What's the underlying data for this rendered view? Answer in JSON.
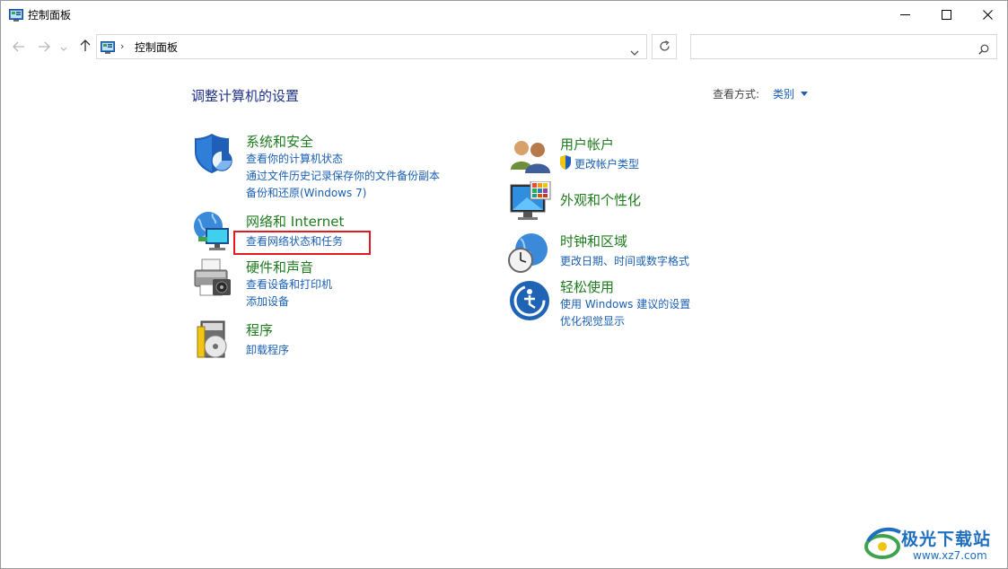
{
  "window": {
    "title": "控制面板",
    "minimize_icon": "minimize-icon",
    "maximize_icon": "maximize-icon",
    "close_icon": "close-icon"
  },
  "nav": {
    "back_icon": "arrow-left-icon",
    "forward_icon": "arrow-right-icon",
    "recent_icon": "chevron-down-icon",
    "up_icon": "arrow-up-icon",
    "breadcrumb_separator": "›",
    "breadcrumb": "控制面板",
    "search_placeholder": "",
    "search_value": ""
  },
  "content": {
    "heading": "调整计算机的设置",
    "view_by_label": "查看方式:",
    "view_by_value": "类别"
  },
  "categories": {
    "system_security": {
      "title": "系统和安全",
      "links": [
        "查看你的计算机状态",
        "通过文件历史记录保存你的文件备份副本",
        "备份和还原(Windows 7)"
      ]
    },
    "network": {
      "title": "网络和 Internet",
      "links": [
        "查看网络状态和任务"
      ]
    },
    "hardware": {
      "title": "硬件和声音",
      "links": [
        "查看设备和打印机",
        "添加设备"
      ]
    },
    "programs": {
      "title": "程序",
      "links": [
        "卸载程序"
      ]
    },
    "user_accounts": {
      "title": "用户帐户",
      "links": [
        "更改帐户类型"
      ]
    },
    "appearance": {
      "title": "外观和个性化",
      "links": []
    },
    "clock_region": {
      "title": "时钟和区域",
      "links": [
        "更改日期、时间或数字格式"
      ]
    },
    "ease_of_access": {
      "title": "轻松使用",
      "links": [
        "使用 Windows 建议的设置",
        "优化视觉显示"
      ]
    }
  },
  "watermark": {
    "line1": "极光下载站",
    "line2": "www.xz7.com"
  },
  "colors": {
    "category_title": "#1e7b1e",
    "link": "#1a5fb4",
    "heading": "#1e3287",
    "highlight": "#e11b22"
  }
}
